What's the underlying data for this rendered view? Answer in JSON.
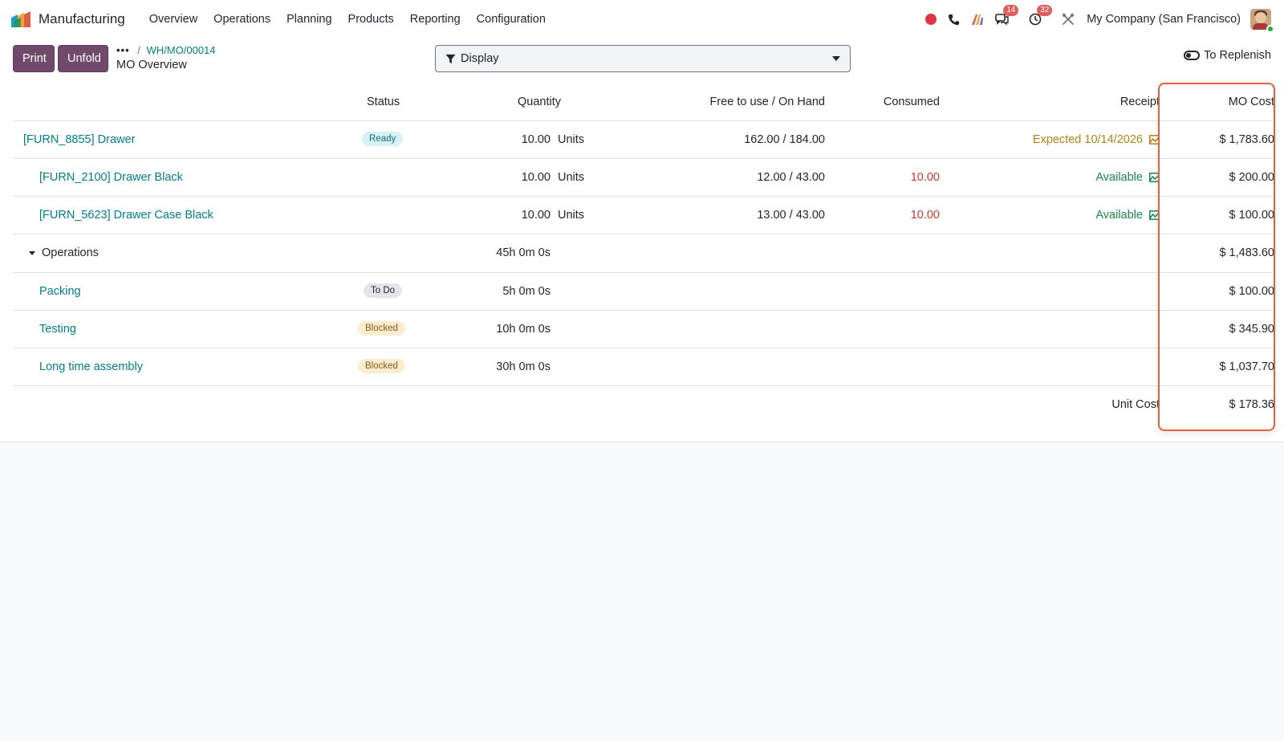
{
  "navbar": {
    "app_name": "Manufacturing",
    "menu": [
      "Overview",
      "Operations",
      "Planning",
      "Products",
      "Reporting",
      "Configuration"
    ],
    "messages_count": "14",
    "activities_count": "32",
    "company": "My Company (San Francisco)"
  },
  "control": {
    "print_label": "Print",
    "unfold_label": "Unfold",
    "breadcrumb_dots": "•••",
    "breadcrumb_sep": "/",
    "breadcrumb_link": "WH/MO/00014",
    "page_title": "MO Overview",
    "display_label": "Display",
    "replenish_label": "To Replenish"
  },
  "table": {
    "headers": {
      "status": "Status",
      "quantity": "Quantity",
      "free_on_hand": "Free to use / On Hand",
      "consumed": "Consumed",
      "receipt": "Receipt",
      "mo_cost": "MO Cost"
    },
    "rows": [
      {
        "name": "[FURN_8855] Drawer",
        "status": "Ready",
        "quantity": "10.00",
        "uom": "Units",
        "free_on_hand": "162.00 / 184.00",
        "consumed": "",
        "receipt": "Expected 10/14/2026",
        "mo_cost": "$ 1,783.60"
      },
      {
        "name": "[FURN_2100] Drawer Black",
        "status": "",
        "quantity": "10.00",
        "uom": "Units",
        "free_on_hand": "12.00 / 43.00",
        "consumed": "10.00",
        "receipt": "Available",
        "mo_cost": "$ 200.00"
      },
      {
        "name": "[FURN_5623] Drawer Case Black",
        "status": "",
        "quantity": "10.00",
        "uom": "Units",
        "free_on_hand": "13.00 / 43.00",
        "consumed": "10.00",
        "receipt": "Available",
        "mo_cost": "$ 100.00"
      },
      {
        "name": "Operations",
        "status": "",
        "quantity": "45h 0m 0s",
        "uom": "",
        "free_on_hand": "",
        "consumed": "",
        "receipt": "",
        "mo_cost": "$ 1,483.60"
      },
      {
        "name": "Packing",
        "status": "To Do",
        "quantity": "5h 0m 0s",
        "uom": "",
        "free_on_hand": "",
        "consumed": "",
        "receipt": "",
        "mo_cost": "$ 100.00"
      },
      {
        "name": "Testing",
        "status": "Blocked",
        "quantity": "10h 0m 0s",
        "uom": "",
        "free_on_hand": "",
        "consumed": "",
        "receipt": "",
        "mo_cost": "$ 345.90"
      },
      {
        "name": "Long time assembly",
        "status": "Blocked",
        "quantity": "30h 0m 0s",
        "uom": "",
        "free_on_hand": "",
        "consumed": "",
        "receipt": "",
        "mo_cost": "$ 1,037.70"
      }
    ],
    "unit_cost_label": "Unit Cost",
    "unit_cost_value": "$ 178.36"
  },
  "colors": {
    "primary": "#71496b",
    "link": "#017e84",
    "highlight": "#e0603f",
    "expected": "#b08316",
    "available": "#19864a",
    "consumed": "#c0392b"
  },
  "icons": [
    "manufacturing-logo-icon",
    "record-icon",
    "phone-icon",
    "ai-icon",
    "chat-icon",
    "clock-icon",
    "tools-icon",
    "filter-icon",
    "toggle-icon",
    "chart-icon",
    "caret-down-icon"
  ]
}
